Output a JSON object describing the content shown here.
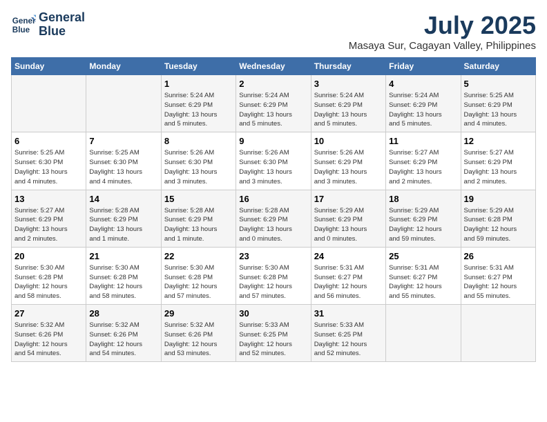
{
  "header": {
    "logo_line1": "General",
    "logo_line2": "Blue",
    "month": "July 2025",
    "location": "Masaya Sur, Cagayan Valley, Philippines"
  },
  "days_of_week": [
    "Sunday",
    "Monday",
    "Tuesday",
    "Wednesday",
    "Thursday",
    "Friday",
    "Saturday"
  ],
  "weeks": [
    [
      {
        "day": "",
        "info": ""
      },
      {
        "day": "",
        "info": ""
      },
      {
        "day": "1",
        "info": "Sunrise: 5:24 AM\nSunset: 6:29 PM\nDaylight: 13 hours\nand 5 minutes."
      },
      {
        "day": "2",
        "info": "Sunrise: 5:24 AM\nSunset: 6:29 PM\nDaylight: 13 hours\nand 5 minutes."
      },
      {
        "day": "3",
        "info": "Sunrise: 5:24 AM\nSunset: 6:29 PM\nDaylight: 13 hours\nand 5 minutes."
      },
      {
        "day": "4",
        "info": "Sunrise: 5:24 AM\nSunset: 6:29 PM\nDaylight: 13 hours\nand 5 minutes."
      },
      {
        "day": "5",
        "info": "Sunrise: 5:25 AM\nSunset: 6:29 PM\nDaylight: 13 hours\nand 4 minutes."
      }
    ],
    [
      {
        "day": "6",
        "info": "Sunrise: 5:25 AM\nSunset: 6:30 PM\nDaylight: 13 hours\nand 4 minutes."
      },
      {
        "day": "7",
        "info": "Sunrise: 5:25 AM\nSunset: 6:30 PM\nDaylight: 13 hours\nand 4 minutes."
      },
      {
        "day": "8",
        "info": "Sunrise: 5:26 AM\nSunset: 6:30 PM\nDaylight: 13 hours\nand 3 minutes."
      },
      {
        "day": "9",
        "info": "Sunrise: 5:26 AM\nSunset: 6:30 PM\nDaylight: 13 hours\nand 3 minutes."
      },
      {
        "day": "10",
        "info": "Sunrise: 5:26 AM\nSunset: 6:29 PM\nDaylight: 13 hours\nand 3 minutes."
      },
      {
        "day": "11",
        "info": "Sunrise: 5:27 AM\nSunset: 6:29 PM\nDaylight: 13 hours\nand 2 minutes."
      },
      {
        "day": "12",
        "info": "Sunrise: 5:27 AM\nSunset: 6:29 PM\nDaylight: 13 hours\nand 2 minutes."
      }
    ],
    [
      {
        "day": "13",
        "info": "Sunrise: 5:27 AM\nSunset: 6:29 PM\nDaylight: 13 hours\nand 2 minutes."
      },
      {
        "day": "14",
        "info": "Sunrise: 5:28 AM\nSunset: 6:29 PM\nDaylight: 13 hours\nand 1 minute."
      },
      {
        "day": "15",
        "info": "Sunrise: 5:28 AM\nSunset: 6:29 PM\nDaylight: 13 hours\nand 1 minute."
      },
      {
        "day": "16",
        "info": "Sunrise: 5:28 AM\nSunset: 6:29 PM\nDaylight: 13 hours\nand 0 minutes."
      },
      {
        "day": "17",
        "info": "Sunrise: 5:29 AM\nSunset: 6:29 PM\nDaylight: 13 hours\nand 0 minutes."
      },
      {
        "day": "18",
        "info": "Sunrise: 5:29 AM\nSunset: 6:29 PM\nDaylight: 12 hours\nand 59 minutes."
      },
      {
        "day": "19",
        "info": "Sunrise: 5:29 AM\nSunset: 6:28 PM\nDaylight: 12 hours\nand 59 minutes."
      }
    ],
    [
      {
        "day": "20",
        "info": "Sunrise: 5:30 AM\nSunset: 6:28 PM\nDaylight: 12 hours\nand 58 minutes."
      },
      {
        "day": "21",
        "info": "Sunrise: 5:30 AM\nSunset: 6:28 PM\nDaylight: 12 hours\nand 58 minutes."
      },
      {
        "day": "22",
        "info": "Sunrise: 5:30 AM\nSunset: 6:28 PM\nDaylight: 12 hours\nand 57 minutes."
      },
      {
        "day": "23",
        "info": "Sunrise: 5:30 AM\nSunset: 6:28 PM\nDaylight: 12 hours\nand 57 minutes."
      },
      {
        "day": "24",
        "info": "Sunrise: 5:31 AM\nSunset: 6:27 PM\nDaylight: 12 hours\nand 56 minutes."
      },
      {
        "day": "25",
        "info": "Sunrise: 5:31 AM\nSunset: 6:27 PM\nDaylight: 12 hours\nand 55 minutes."
      },
      {
        "day": "26",
        "info": "Sunrise: 5:31 AM\nSunset: 6:27 PM\nDaylight: 12 hours\nand 55 minutes."
      }
    ],
    [
      {
        "day": "27",
        "info": "Sunrise: 5:32 AM\nSunset: 6:26 PM\nDaylight: 12 hours\nand 54 minutes."
      },
      {
        "day": "28",
        "info": "Sunrise: 5:32 AM\nSunset: 6:26 PM\nDaylight: 12 hours\nand 54 minutes."
      },
      {
        "day": "29",
        "info": "Sunrise: 5:32 AM\nSunset: 6:26 PM\nDaylight: 12 hours\nand 53 minutes."
      },
      {
        "day": "30",
        "info": "Sunrise: 5:33 AM\nSunset: 6:25 PM\nDaylight: 12 hours\nand 52 minutes."
      },
      {
        "day": "31",
        "info": "Sunrise: 5:33 AM\nSunset: 6:25 PM\nDaylight: 12 hours\nand 52 minutes."
      },
      {
        "day": "",
        "info": ""
      },
      {
        "day": "",
        "info": ""
      }
    ]
  ]
}
